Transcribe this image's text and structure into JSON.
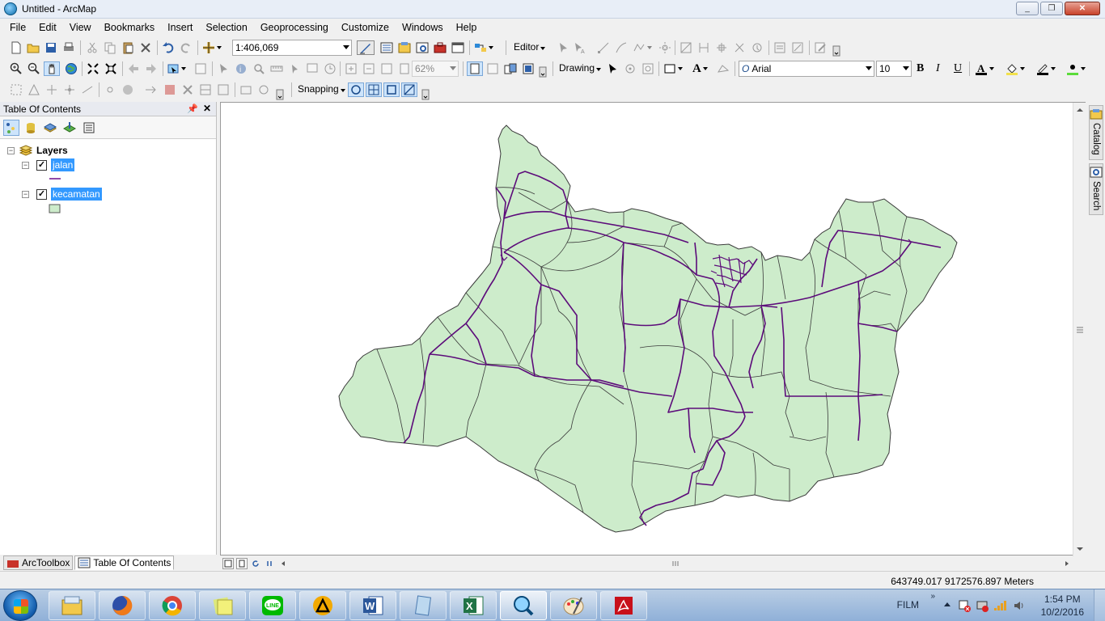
{
  "window": {
    "title": "Untitled - ArcMap",
    "minimize": "_",
    "maximize": "❐",
    "close": "✕"
  },
  "menu": [
    "File",
    "Edit",
    "View",
    "Bookmarks",
    "Insert",
    "Selection",
    "Geoprocessing",
    "Customize",
    "Windows",
    "Help"
  ],
  "standard_toolbar": {
    "scale": "1:406,069",
    "editor_label": "Editor"
  },
  "draw_toolbar": {
    "zoom_percent": "62%",
    "drawing_label": "Drawing",
    "font": "Arial",
    "font_size": "10",
    "bold": "B",
    "italic": "I",
    "underline": "U",
    "text_tool": "A"
  },
  "snap_toolbar": {
    "snapping_label": "Snapping"
  },
  "toc": {
    "title": "Table Of Contents",
    "pin": "📌",
    "close": "✕",
    "root": "Layers",
    "layers": [
      {
        "name": "jalan",
        "checked": true,
        "symbol": "line",
        "color": "#6a0a8c"
      },
      {
        "name": "kecamatan",
        "checked": true,
        "symbol": "fill",
        "color": "#cdeccb"
      }
    ],
    "check_mark": "✓",
    "collapse_mark": "−"
  },
  "bottom_tabs": [
    "ArcToolbox",
    "Table Of Contents"
  ],
  "right_dock": [
    "Catalog",
    "Search"
  ],
  "status": {
    "coordinates": "643749.017  9172576.897 Meters"
  },
  "taskbar": {
    "apps": [
      "explorer-icon",
      "firefox-icon",
      "chrome-icon",
      "sticky-notes-icon",
      "line-icon",
      "arcgis-icon",
      "word-icon",
      "notepad-icon",
      "excel-icon",
      "arcmap-icon",
      "paint-icon",
      "acrobat-icon"
    ],
    "tray_label": "FILM",
    "tray_chevron": "»",
    "time": "1:54 PM",
    "date": "10/2/2016"
  },
  "colors": {
    "fill": "#cdeccb",
    "outline": "#3a3a3a",
    "road": "#5c0b7a",
    "selection": "#3399ff"
  }
}
